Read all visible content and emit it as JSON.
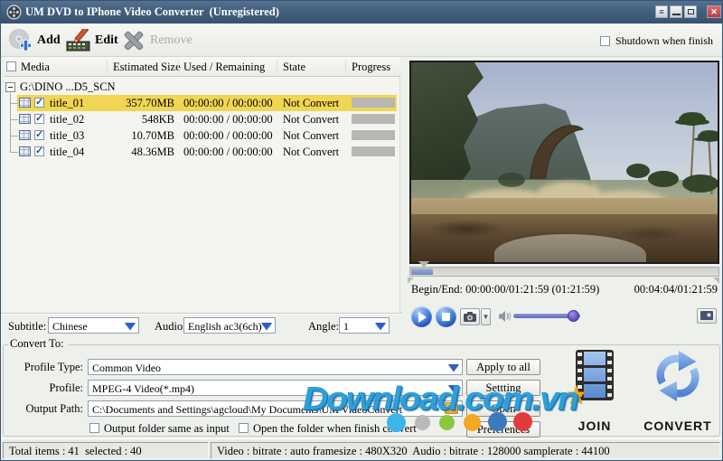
{
  "titlebar": {
    "title": "UM DVD to IPhone Video Converter  (Unregistered)"
  },
  "toolbar": {
    "add_label": "Add",
    "edit_label": "Edit",
    "remove_label": "Remove",
    "shutdown_label": "Shutdown when finish"
  },
  "media_list": {
    "columns": {
      "media": "Media",
      "size": "Estimated Size",
      "used": "Used / Remaining",
      "state": "State",
      "progress": "Progress"
    },
    "root_label": "G:\\DINO ...D5_SCN",
    "rows": [
      {
        "name": "title_01",
        "size": "357.70MB",
        "used": "00:00:00 / 00:00:00",
        "state": "Not Convert"
      },
      {
        "name": "title_02",
        "size": "548KB",
        "used": "00:00:00 / 00:00:00",
        "state": "Not Convert"
      },
      {
        "name": "title_03",
        "size": "10.70MB",
        "used": "00:00:00 / 00:00:00",
        "state": "Not Convert"
      },
      {
        "name": "title_04",
        "size": "48.36MB",
        "used": "00:00:00 / 00:00:00",
        "state": "Not Convert"
      }
    ]
  },
  "stream_bar": {
    "subtitle_label": "Subtitle:",
    "subtitle_value": "Chinese",
    "audio_label": "Audio:",
    "audio_value": "English ac3(6ch)",
    "angle_label": "Angle:",
    "angle_value": "1"
  },
  "player": {
    "begin_end": "Begin/End: 00:00:00/01:21:59 (01:21:59)",
    "position": "00:04:04/01:21:59"
  },
  "convert_panel": {
    "group_label": "Convert To:",
    "profile_type_label": "Profile Type:",
    "profile_type_value": "Common Video",
    "profile_label": "Profile:",
    "profile_value": "MPEG-4 Video(*.mp4)",
    "output_path_label": "Output Path:",
    "output_path_value": "C:\\Documents and Settings\\agcloud\\My Documents\\UM VideoConvert",
    "apply_to_all_label": "Apply to all",
    "setting_label": "Settting",
    "open_label": "Open",
    "preferences_label": "Preferences",
    "same_as_input_label": "Output folder same as input",
    "open_when_finish_label": "Open the folder when finish convert",
    "join_label": "JOIN",
    "convert_label": "CONVERT"
  },
  "statusbar": {
    "items": "Total items : 41  selected : 40",
    "info": "Video : bitrate : auto framesize : 480X320  Audio : bitrate : 128000 samplerate : 44100"
  },
  "watermark": {
    "text": "Download.com.vn"
  },
  "colors": {
    "titlebar": "#42607e",
    "selected_row": "#f1d654",
    "accent_blue": "#2d5fc4",
    "watermark_blue": "#2d9fd9"
  }
}
